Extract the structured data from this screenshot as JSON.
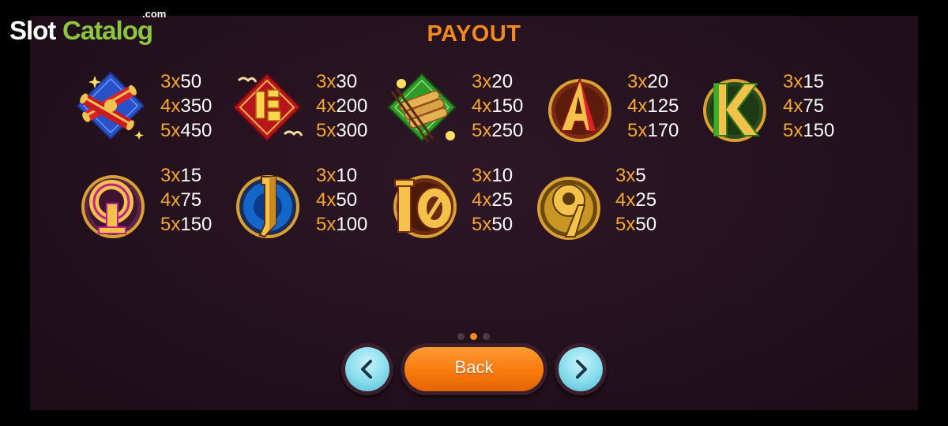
{
  "logo": {
    "brand_part1": "Slot",
    "brand_part2": "Catalog",
    "suffix": ".com"
  },
  "title": "PAYOUT",
  "symbols": [
    {
      "icon": "firecrackers-icon",
      "pays": [
        {
          "mult": "3x",
          "value": "50"
        },
        {
          "mult": "4x",
          "value": "350"
        },
        {
          "mult": "5x",
          "value": "450"
        }
      ]
    },
    {
      "icon": "fu-character-icon",
      "pays": [
        {
          "mult": "3x",
          "value": "30"
        },
        {
          "mult": "4x",
          "value": "200"
        },
        {
          "mult": "5x",
          "value": "300"
        }
      ]
    },
    {
      "icon": "spring-rolls-icon",
      "pays": [
        {
          "mult": "3x",
          "value": "20"
        },
        {
          "mult": "4x",
          "value": "150"
        },
        {
          "mult": "5x",
          "value": "250"
        }
      ]
    },
    {
      "icon": "letter-a-icon",
      "pays": [
        {
          "mult": "3x",
          "value": "20"
        },
        {
          "mult": "4x",
          "value": "125"
        },
        {
          "mult": "5x",
          "value": "170"
        }
      ]
    },
    {
      "icon": "letter-k-icon",
      "pays": [
        {
          "mult": "3x",
          "value": "15"
        },
        {
          "mult": "4x",
          "value": "75"
        },
        {
          "mult": "5x",
          "value": "150"
        }
      ]
    },
    {
      "icon": "letter-q-icon",
      "pays": [
        {
          "mult": "3x",
          "value": "15"
        },
        {
          "mult": "4x",
          "value": "75"
        },
        {
          "mult": "5x",
          "value": "150"
        }
      ]
    },
    {
      "icon": "letter-j-icon",
      "pays": [
        {
          "mult": "3x",
          "value": "10"
        },
        {
          "mult": "4x",
          "value": "50"
        },
        {
          "mult": "5x",
          "value": "100"
        }
      ]
    },
    {
      "icon": "number-10-icon",
      "pays": [
        {
          "mult": "3x",
          "value": "10"
        },
        {
          "mult": "4x",
          "value": "25"
        },
        {
          "mult": "5x",
          "value": "50"
        }
      ]
    },
    {
      "icon": "number-9-icon",
      "pays": [
        {
          "mult": "3x",
          "value": "5"
        },
        {
          "mult": "4x",
          "value": "25"
        },
        {
          "mult": "5x",
          "value": "50"
        }
      ]
    }
  ],
  "pagination": {
    "total": 3,
    "current": 2
  },
  "buttons": {
    "prev_icon": "chevron-left-icon",
    "back_label": "Back",
    "next_icon": "chevron-right-icon"
  },
  "colors": {
    "accent": "#f28a1d",
    "multiplier": "#f5a733",
    "nav_button": "#86dcec",
    "back_button": "#f97a0e"
  }
}
